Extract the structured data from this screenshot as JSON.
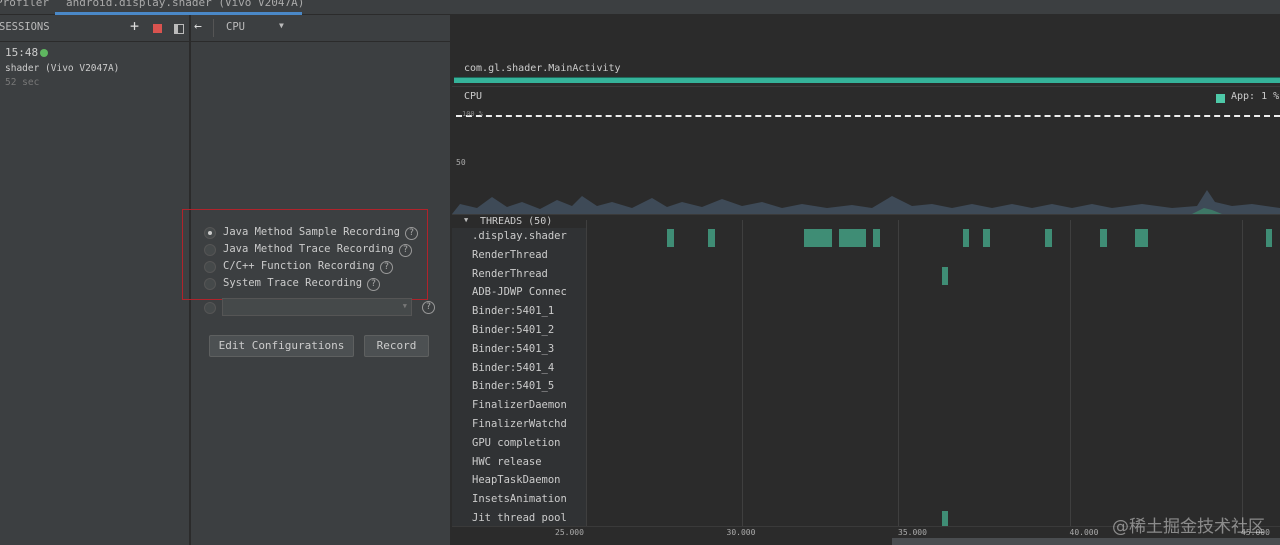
{
  "tabs": {
    "profiler": "Profiler",
    "session_tab": "android.display.shader (Vivo V2047A)"
  },
  "sessions": {
    "header": "SESSIONS",
    "time": "15:48",
    "name": "shader (Vivo V2047A)",
    "duration": "52 sec",
    "status_color": "#5fb760"
  },
  "toolbar": {
    "add": "+",
    "back": "←",
    "monitor": "CPU"
  },
  "recording": {
    "options": [
      {
        "label": "Java Method Sample Recording",
        "selected": true
      },
      {
        "label": "Java Method Trace Recording",
        "selected": false
      },
      {
        "label": "C/C++ Function Recording",
        "selected": false
      },
      {
        "label": "System Trace Recording",
        "selected": false
      }
    ],
    "config_value": "",
    "help": "?",
    "edit_label": "Edit Configurations",
    "record_label": "Record"
  },
  "activity": "com.gl.shader.MainActivity",
  "cpu": {
    "title": "CPU",
    "legend": "App: 1 %",
    "y_top": "100 %",
    "y_mid": "50"
  },
  "threads": {
    "header": "THREADS (50)",
    "names": [
      ".display.shader",
      "RenderThread",
      "RenderThread",
      "ADB-JDWP Connec",
      "Binder:5401_1",
      "Binder:5401_2",
      "Binder:5401_3",
      "Binder:5401_4",
      "Binder:5401_5",
      "FinalizerDaemon",
      "FinalizerWatchd",
      "GPU completion",
      "HWC release",
      "HeapTaskDaemon",
      "InsetsAnimation",
      "Jit thread pool"
    ]
  },
  "activity_spans": [
    {
      "row": 0,
      "start": 27.83,
      "end": 28.03
    },
    {
      "row": 0,
      "start": 29.02,
      "end": 29.23
    },
    {
      "row": 0,
      "start": 31.82,
      "end": 32.64
    },
    {
      "row": 0,
      "start": 32.84,
      "end": 33.63
    },
    {
      "row": 0,
      "start": 33.83,
      "end": 34.04
    },
    {
      "row": 0,
      "start": 36.46,
      "end": 36.63
    },
    {
      "row": 0,
      "start": 37.04,
      "end": 37.24
    },
    {
      "row": 0,
      "start": 38.85,
      "end": 39.05
    },
    {
      "row": 0,
      "start": 40.45,
      "end": 40.66
    },
    {
      "row": 0,
      "start": 41.47,
      "end": 41.85
    },
    {
      "row": 0,
      "start": 45.29,
      "end": 45.47
    },
    {
      "row": 2,
      "start": 35.85,
      "end": 36.02
    },
    {
      "row": 15,
      "start": 35.85,
      "end": 36.02
    }
  ],
  "axis": {
    "ticks": [
      "25.000",
      "30.000",
      "35.000",
      "40.000",
      "45.000"
    ],
    "tick_values": [
      25,
      30,
      35,
      40,
      45
    ]
  },
  "watermark": "@稀土掘金技术社区"
}
